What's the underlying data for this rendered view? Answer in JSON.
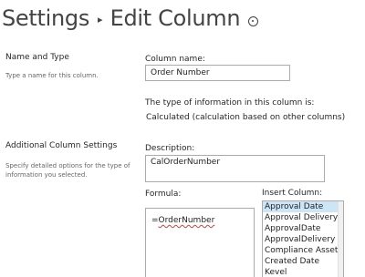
{
  "header": {
    "crumb_settings": "Settings",
    "separator": "▸",
    "crumb_edit": "Edit Column"
  },
  "name_type": {
    "heading": "Name and Type",
    "description": "Type a name for this column."
  },
  "column_name": {
    "label": "Column name:",
    "value": "Order Number"
  },
  "type_info": {
    "label": "The type of information in this column is:",
    "value": "Calculated (calculation based on other columns)"
  },
  "additional": {
    "heading": "Additional Column Settings",
    "description": "Specify detailed options for the type of information you selected."
  },
  "description_field": {
    "label": "Description:",
    "value": "CalOrderNumber"
  },
  "formula": {
    "label": "Formula:",
    "prefix": "=",
    "reference": "OrderNumber"
  },
  "insert_column": {
    "label": "Insert Column:",
    "items": [
      "Approval Date",
      "Approval Delivery",
      "ApprovalDate",
      "ApprovalDelivery",
      "Compliance Asset Id",
      "Created Date",
      "Kevel"
    ],
    "selected_index": 0
  },
  "colors": {
    "selected_item": "#cde6f7",
    "spell_underline": "#d0403a"
  }
}
